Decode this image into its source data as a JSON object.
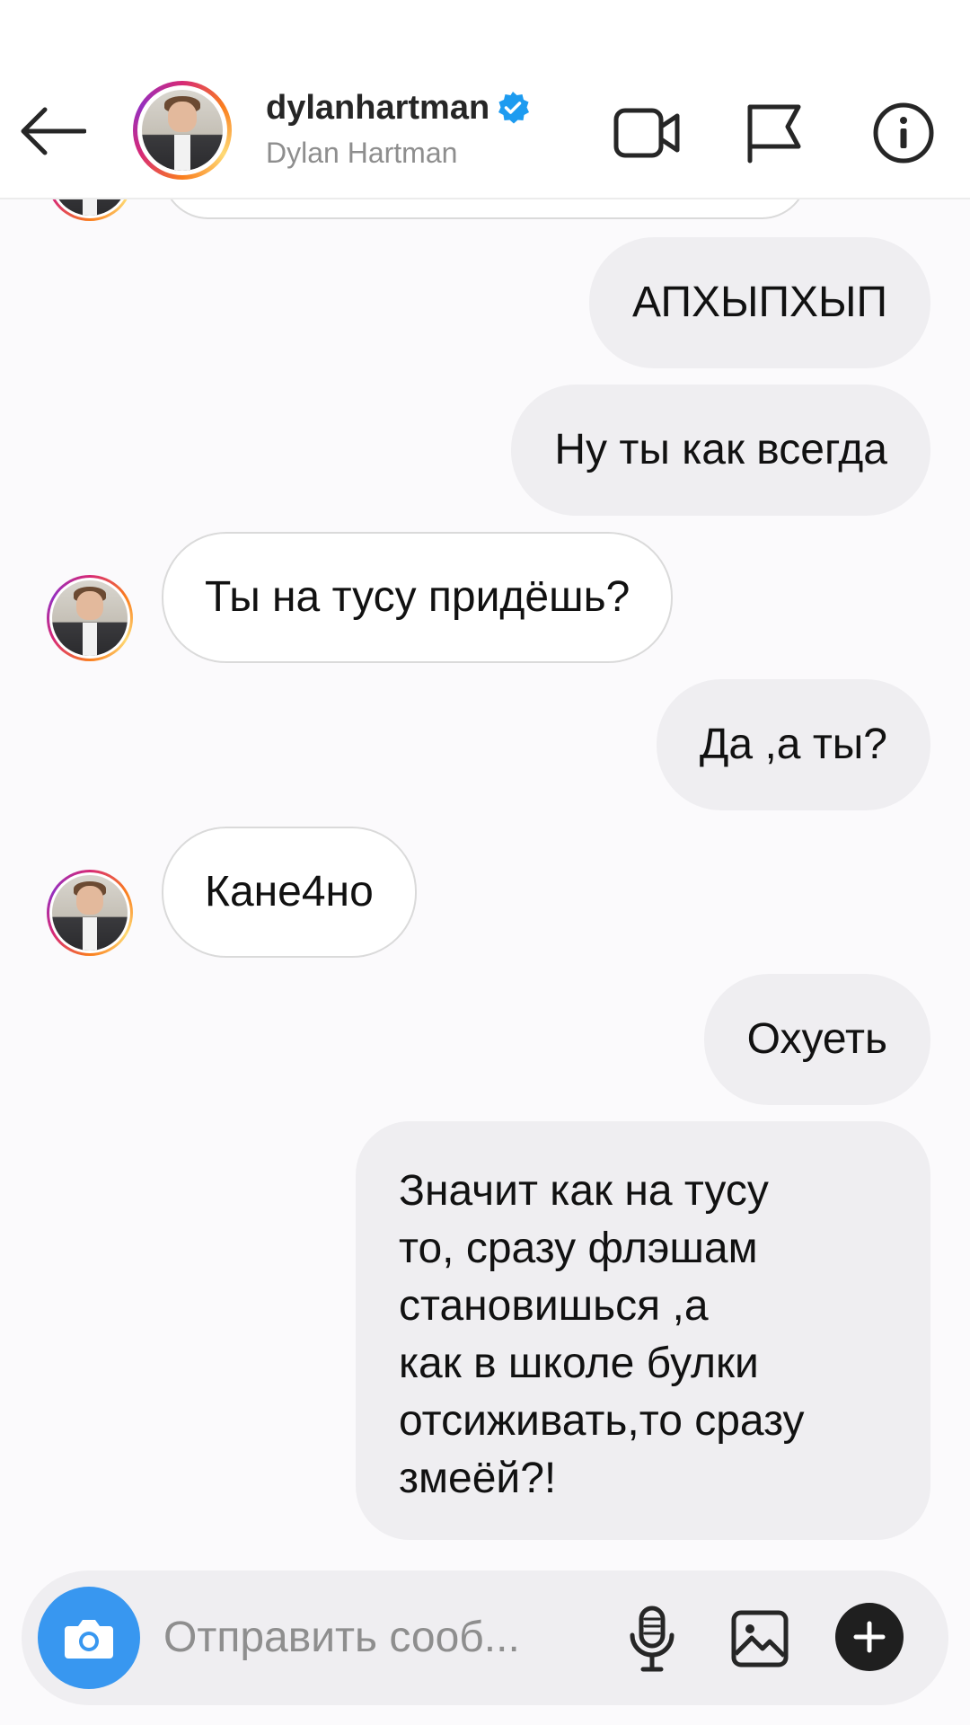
{
  "header": {
    "username": "dylanhartman",
    "full_name": "Dylan Hartman",
    "verified": true,
    "icons": [
      "back-arrow-icon",
      "video-call-icon",
      "flag-icon",
      "info-icon"
    ]
  },
  "messages": [
    {
      "direction": "in",
      "text": ""
    },
    {
      "direction": "out",
      "text": "АПХЫПХЫП"
    },
    {
      "direction": "out",
      "text": "Ну ты как всегда"
    },
    {
      "direction": "in",
      "text": "Ты на тусу придёшь?"
    },
    {
      "direction": "out",
      "text": "Да ,а ты?"
    },
    {
      "direction": "in",
      "text": "Кане4но"
    },
    {
      "direction": "out",
      "text": "Охуеть"
    },
    {
      "direction": "out",
      "text": "Значит как на тусу\nто, сразу флэшам\nстановишься ,а\nкак в школе булки\nотсиживать,то сразу\nзмеёй?!"
    }
  ],
  "composer": {
    "placeholder": "Отправить сооб...",
    "icons": [
      "camera-icon",
      "microphone-icon",
      "gallery-icon",
      "plus-icon"
    ]
  },
  "colors": {
    "accent_blue": "#3897f0",
    "verified_blue": "#1d9bf0",
    "outgoing_bubble": "#efeef1",
    "incoming_border": "#dadada"
  }
}
